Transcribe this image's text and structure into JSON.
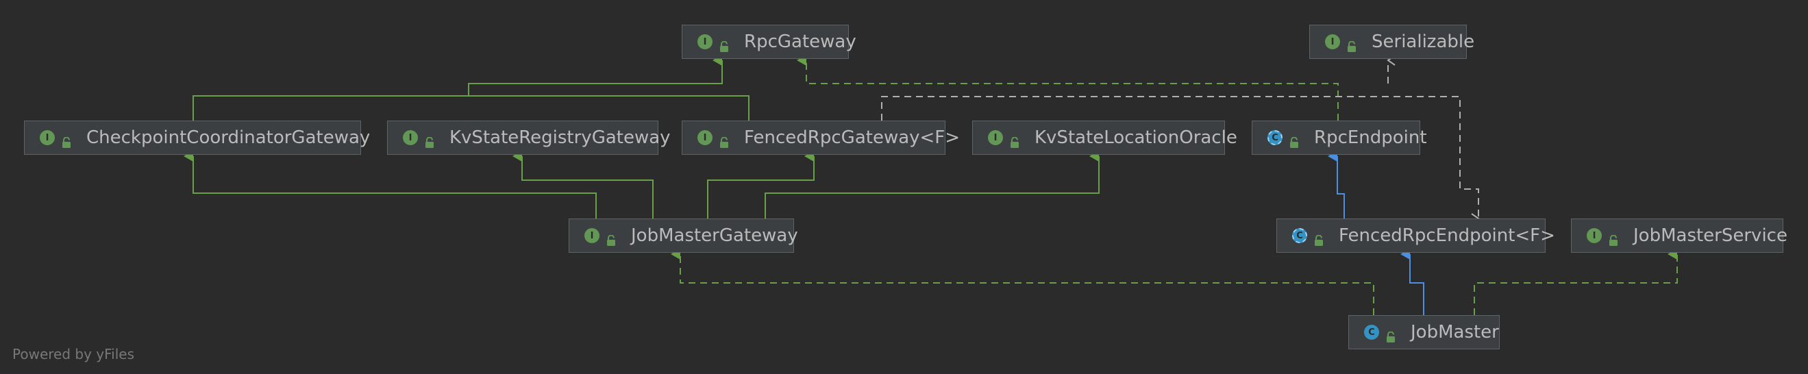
{
  "colors": {
    "background": "#2b2b2b",
    "node_fill": "#3c3f41",
    "node_border": "#5e6366",
    "text": "#bbbbbb",
    "interface_badge": "#629755",
    "class_badge": "#3592c4",
    "extends_edge": "#6a9f4a",
    "implements_class_edge": "#4a8fe0",
    "serializable_edge": "#b0b0b0"
  },
  "nodes": [
    {
      "id": "rpc-gateway",
      "label": "RpcGateway",
      "kind": "interface",
      "badge": "I",
      "icon": "public-lock-icon"
    },
    {
      "id": "serializable",
      "label": "Serializable",
      "kind": "interface",
      "badge": "I",
      "icon": "public-lock-icon"
    },
    {
      "id": "checkpoint-coordinator-gateway",
      "label": "CheckpointCoordinatorGateway",
      "kind": "interface",
      "badge": "I",
      "icon": "public-lock-icon"
    },
    {
      "id": "kv-state-registry-gateway",
      "label": "KvStateRegistryGateway",
      "kind": "interface",
      "badge": "I",
      "icon": "public-lock-icon"
    },
    {
      "id": "fenced-rpc-gateway",
      "label": "FencedRpcGateway<F>",
      "kind": "interface",
      "badge": "I",
      "icon": "public-lock-icon"
    },
    {
      "id": "kv-state-location-oracle",
      "label": "KvStateLocationOracle",
      "kind": "interface",
      "badge": "I",
      "icon": "public-lock-icon"
    },
    {
      "id": "rpc-endpoint",
      "label": "RpcEndpoint",
      "kind": "abstract",
      "badge": "C",
      "icon": "public-lock-icon"
    },
    {
      "id": "job-master-gateway",
      "label": "JobMasterGateway",
      "kind": "interface",
      "badge": "I",
      "icon": "public-lock-icon"
    },
    {
      "id": "fenced-rpc-endpoint",
      "label": "FencedRpcEndpoint<F>",
      "kind": "abstract",
      "badge": "C",
      "icon": "public-lock-icon"
    },
    {
      "id": "job-master-service",
      "label": "JobMasterService",
      "kind": "interface",
      "badge": "I",
      "icon": "public-lock-icon"
    },
    {
      "id": "job-master",
      "label": "JobMaster",
      "kind": "class",
      "badge": "C",
      "icon": "public-lock-icon"
    }
  ],
  "edges": [
    {
      "from": "checkpoint-coordinator-gateway",
      "to": "rpc-gateway",
      "relation": "extends"
    },
    {
      "from": "fenced-rpc-gateway",
      "to": "rpc-gateway",
      "relation": "extends"
    },
    {
      "from": "job-master-gateway",
      "to": "checkpoint-coordinator-gateway",
      "relation": "extends"
    },
    {
      "from": "job-master-gateway",
      "to": "kv-state-registry-gateway",
      "relation": "extends"
    },
    {
      "from": "job-master-gateway",
      "to": "fenced-rpc-gateway",
      "relation": "extends"
    },
    {
      "from": "job-master-gateway",
      "to": "kv-state-location-oracle",
      "relation": "extends"
    },
    {
      "from": "fenced-rpc-endpoint",
      "to": "rpc-endpoint",
      "relation": "extends"
    },
    {
      "from": "job-master",
      "to": "fenced-rpc-endpoint",
      "relation": "extends"
    },
    {
      "from": "rpc-endpoint",
      "to": "rpc-gateway",
      "relation": "implements"
    },
    {
      "from": "fenced-rpc-gateway",
      "to": "serializable",
      "relation": "implements"
    },
    {
      "from": "fenced-rpc-endpoint",
      "to": "serializable",
      "relation": "implements"
    },
    {
      "from": "job-master",
      "to": "job-master-gateway",
      "relation": "implements"
    },
    {
      "from": "job-master",
      "to": "job-master-service",
      "relation": "implements"
    }
  ],
  "footer": {
    "text": "Powered by yFiles"
  }
}
